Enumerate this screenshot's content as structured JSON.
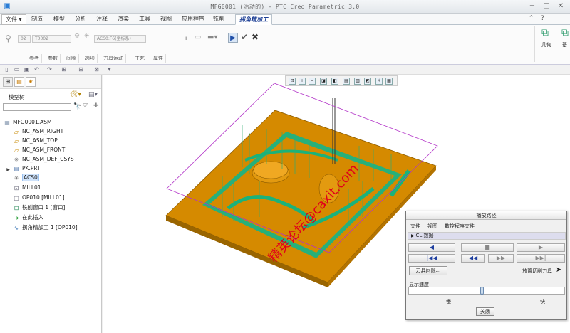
{
  "window": {
    "title": "MFG0001 (活动的) - PTC Creo Parametric 3.0",
    "min": "−",
    "max": "□",
    "close": "✕"
  },
  "tabs": [
    {
      "label": "文件 ▾"
    },
    {
      "label": "制造"
    },
    {
      "label": "模型"
    },
    {
      "label": "分析"
    },
    {
      "label": "注释"
    },
    {
      "label": "渲染"
    },
    {
      "label": "工具"
    },
    {
      "label": "视图"
    },
    {
      "label": "应用程序"
    },
    {
      "label": "铣削"
    },
    {
      "label": "拐角精加工"
    }
  ],
  "ribbon": {
    "field1": "02",
    "field2": "T0002",
    "field3": "ACS0:F6(坐标系)",
    "subtabs": [
      "参考",
      "参数",
      "间隙",
      "选项",
      "刀具运动",
      "工艺",
      "属性"
    ],
    "geometry_label": "几何",
    "base_label": "基"
  },
  "left_panel": {
    "tree_title": "模型树",
    "tree": [
      {
        "label": "MFG0001.ASM",
        "icon": "assembly-icon"
      },
      {
        "label": "NC_ASM_RIGHT",
        "icon": "datum-plane-icon"
      },
      {
        "label": "NC_ASM_TOP",
        "icon": "datum-plane-icon"
      },
      {
        "label": "NC_ASM_FRONT",
        "icon": "datum-plane-icon"
      },
      {
        "label": "NC_ASM_DEF_CSYS",
        "icon": "csys-icon"
      },
      {
        "label": "PK.PRT",
        "icon": "part-icon"
      },
      {
        "label": "ACS0",
        "icon": "csys-icon"
      },
      {
        "label": "MILL01",
        "icon": "workcell-icon"
      },
      {
        "label": "OP010 [MILL01]",
        "icon": "operation-icon"
      },
      {
        "label": "铣削窗口 1 [窗口]",
        "icon": "mill-window-icon"
      },
      {
        "label": "在此插入",
        "icon": "insert-arrow-icon"
      },
      {
        "label": "拐角精加工 1 [OP010]",
        "icon": "toolpath-icon"
      }
    ]
  },
  "dialog": {
    "title": "播放路径",
    "menu": [
      "文件",
      "视图",
      "数控程序文件"
    ],
    "cl_data": "CL 数据",
    "buttons_row1": [
      "◀",
      "■",
      "▶"
    ],
    "buttons_row2": [
      "|◀◀",
      "◀◀",
      "▶▶",
      "▶▶|"
    ],
    "tool_clearance": "刀具间隙...",
    "place_tool": "放置切削刀具",
    "speed_label": "显示速度",
    "speed_value": 0.47,
    "slow": "慢",
    "fast": "快",
    "close": "关闭"
  },
  "watermark": "精英论坛@caxit.com",
  "colors": {
    "part_orange": "#d98c00",
    "toolpath_green": "#1bb27a",
    "selection_blue": "#cfe3fb",
    "active_tab": "#1c3f95",
    "watermark_red": "#e0001a"
  }
}
